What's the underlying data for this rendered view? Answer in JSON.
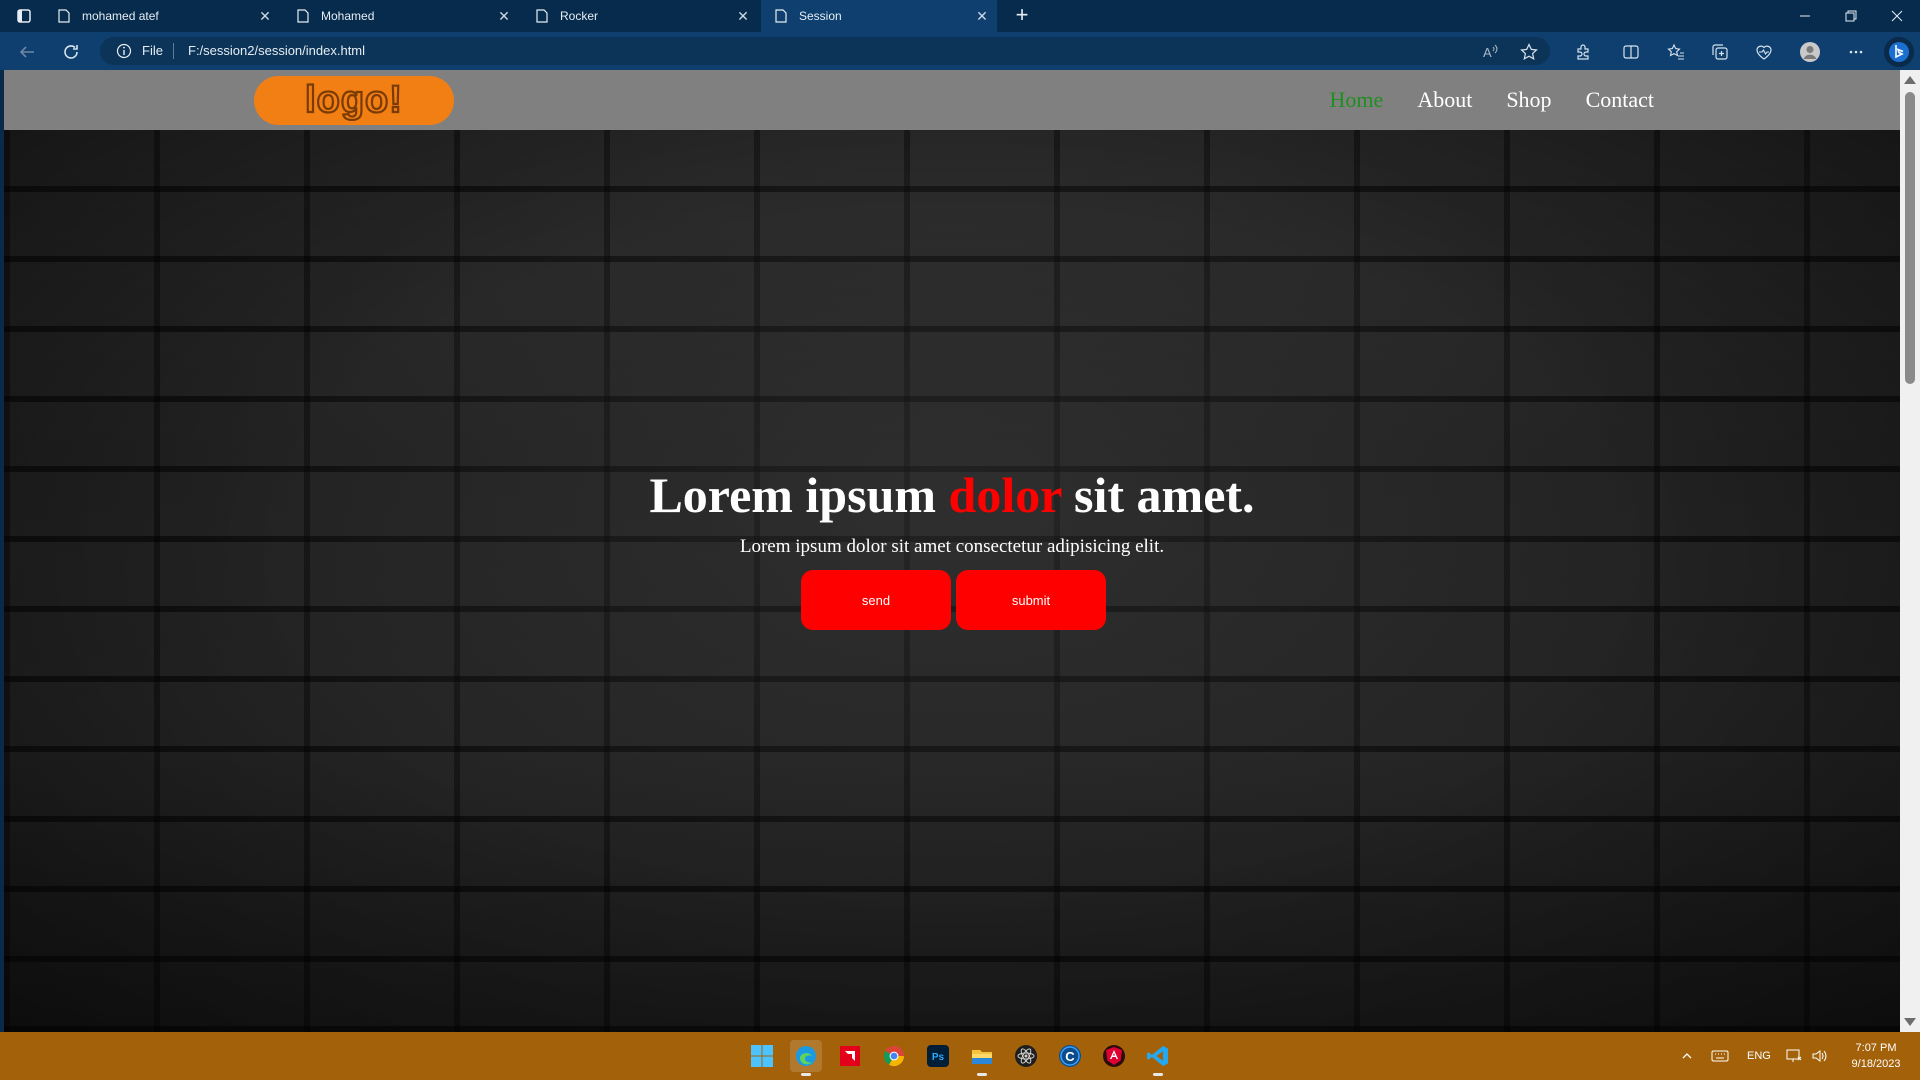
{
  "browser": {
    "tabs": [
      {
        "title": "mohamed atef",
        "active": false
      },
      {
        "title": "Mohamed",
        "active": false
      },
      {
        "title": "Rocker",
        "active": false
      },
      {
        "title": "Session",
        "active": true
      }
    ],
    "address": {
      "scheme_label": "File",
      "url": "F:/session2/session/index.html"
    }
  },
  "site": {
    "logo_text": "logo!",
    "nav": [
      {
        "label": "Home",
        "active": true
      },
      {
        "label": "About",
        "active": false
      },
      {
        "label": "Shop",
        "active": false
      },
      {
        "label": "Contact",
        "active": false
      }
    ],
    "hero": {
      "title_before": "Lorem ipsum ",
      "title_highlight": "dolor",
      "title_after": " sit amet.",
      "subtitle": "Lorem ipsum dolor sit amet consectetur adipisicing elit.",
      "buttons": [
        {
          "label": "send"
        },
        {
          "label": "submit"
        }
      ]
    },
    "colors": {
      "header_bg": "#808080",
      "nav_active": "#1f8f1f",
      "accent": "#ff0000",
      "logo_bg": "#f27f14"
    }
  },
  "taskbar": {
    "apps": [
      "windows-start-icon",
      "edge-icon",
      "amd-icon",
      "chrome-icon",
      "photoshop-icon",
      "file-explorer-icon",
      "react-icon",
      "ccleaner-icon",
      "angular-icon",
      "vscode-icon"
    ],
    "tray": {
      "language": "ENG",
      "time": "7:07 PM",
      "date": "9/18/2023"
    },
    "color": "#a3620a"
  }
}
